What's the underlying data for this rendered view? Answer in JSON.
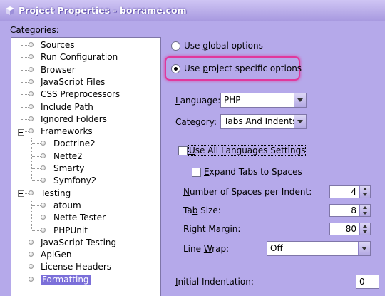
{
  "window": {
    "title": "Project Properties - borrame.com"
  },
  "categories": {
    "label_u": "C",
    "label_rest": "ategories:",
    "items": [
      {
        "label": "Sources"
      },
      {
        "label": "Run Configuration"
      },
      {
        "label": "Browser"
      },
      {
        "label": "JavaScript Files"
      },
      {
        "label": "CSS Preprocessors"
      },
      {
        "label": "Include Path"
      },
      {
        "label": "Ignored Folders"
      },
      {
        "label": "Frameworks"
      },
      {
        "label": "Doctrine2"
      },
      {
        "label": "Nette2"
      },
      {
        "label": "Smarty"
      },
      {
        "label": "Symfony2"
      },
      {
        "label": "Testing"
      },
      {
        "label": "atoum"
      },
      {
        "label": "Nette Tester"
      },
      {
        "label": "PHPUnit"
      },
      {
        "label": "JavaScript Testing"
      },
      {
        "label": "ApiGen"
      },
      {
        "label": "License Headers"
      },
      {
        "label": "Formatting"
      }
    ],
    "selected": "Formatting"
  },
  "options": {
    "global_pre": "Use ",
    "global_u": "g",
    "global_post": "lobal options",
    "global_checked": false,
    "project_pre": "Use ",
    "project_u": "p",
    "project_post": "roject specific options",
    "project_checked": true
  },
  "language": {
    "label_u": "L",
    "label_rest": "anguage:",
    "value": "PHP"
  },
  "category": {
    "label_u": "C",
    "label_rest": "ategory:",
    "value": "Tabs And Indents"
  },
  "use_all_languages": {
    "label_u": "U",
    "label_rest": "se All Languages Settings",
    "checked": false
  },
  "expand_tabs": {
    "label_u": "E",
    "label_rest": "xpand Tabs to Spaces",
    "checked": false
  },
  "spaces_per_indent": {
    "label_u": "N",
    "label_rest": "umber of Spaces per Indent:",
    "value": "4"
  },
  "tab_size": {
    "label_pre": "Ta",
    "label_u": "b",
    "label_post": " Size:",
    "value": "8"
  },
  "right_margin": {
    "label_u": "R",
    "label_rest": "ight Margin:",
    "value": "80"
  },
  "line_wrap": {
    "label_pre": "Line ",
    "label_u": "W",
    "label_post": "rap:",
    "value": "Off"
  },
  "initial_indentation": {
    "label_u": "I",
    "label_rest": "nitial Indentation:",
    "value": "0"
  },
  "colors": {
    "background": "#b5a9ea",
    "selection": "#7b6fd9",
    "highlight_ring": "#e0389c"
  }
}
